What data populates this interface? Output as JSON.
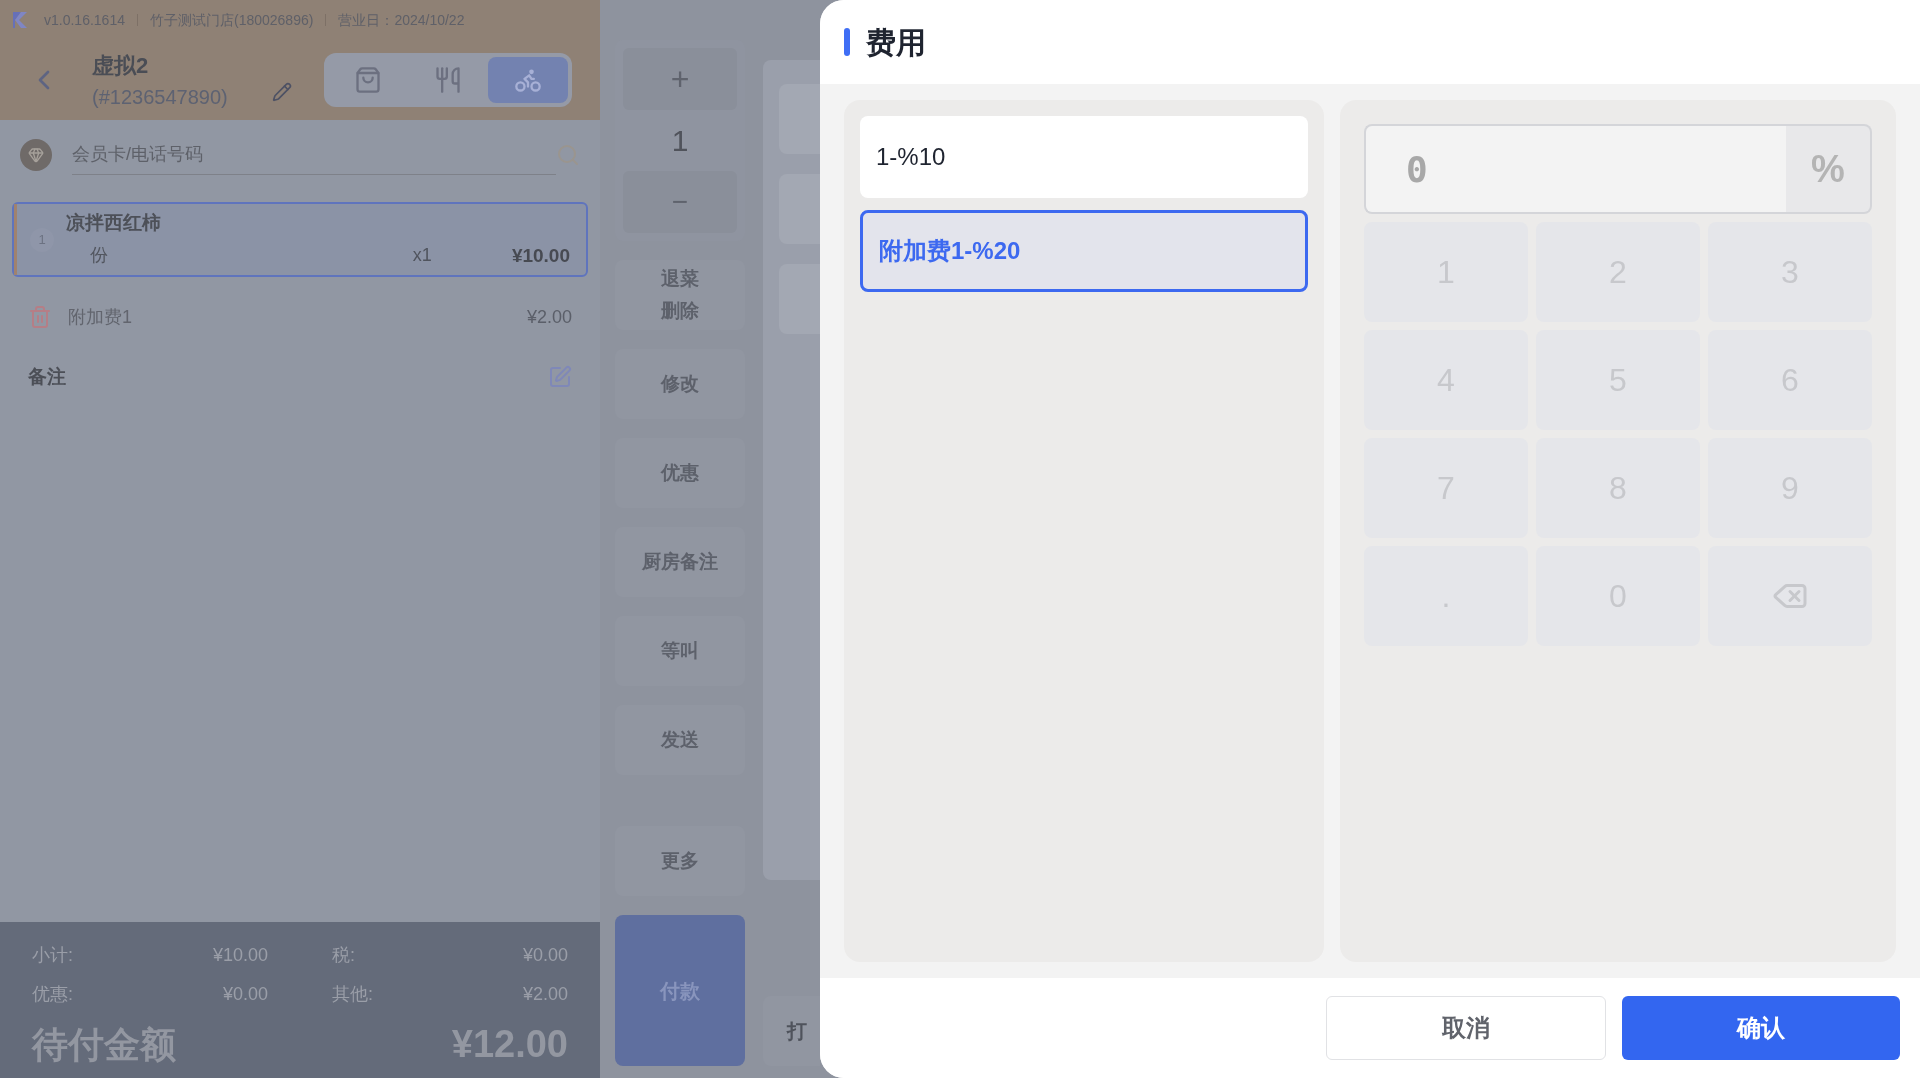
{
  "status_bar": {
    "version": "v1.0.16.1614",
    "store": "竹子测试门店(180026896)",
    "business_day": "营业日：2024/10/22"
  },
  "order": {
    "title": "虚拟2",
    "number": "(#1236547890)"
  },
  "mode_tabs": [
    {
      "kind": "bag",
      "selected": false
    },
    {
      "kind": "dine",
      "selected": false
    },
    {
      "kind": "delivery",
      "selected": true
    }
  ],
  "member_search": {
    "placeholder": "会员卡/电话号码"
  },
  "items": [
    {
      "index": "1",
      "name": "凉拌西红柿",
      "unit": "份",
      "qty": "x1",
      "price": "¥10.00",
      "selected": true
    }
  ],
  "surcharges": [
    {
      "name": "附加费1",
      "amount": "¥2.00"
    }
  ],
  "note_label": "备注",
  "summary": [
    {
      "label": "小计:",
      "value": "¥10.00"
    },
    {
      "label": "税:",
      "value": "¥0.00"
    },
    {
      "label": "优惠:",
      "value": "¥0.00"
    },
    {
      "label": "其他:",
      "value": "¥2.00"
    }
  ],
  "total": {
    "label": "待付金额",
    "value": "¥12.00"
  },
  "quantity": {
    "plus": "+",
    "value": "1",
    "minus": "−"
  },
  "actions": [
    {
      "lines": [
        "退菜",
        "删除"
      ]
    },
    {
      "lines": [
        "修改"
      ]
    },
    {
      "lines": [
        "优惠"
      ]
    },
    {
      "lines": [
        "厨房备注"
      ]
    },
    {
      "lines": [
        "等叫"
      ]
    },
    {
      "lines": [
        "发送"
      ]
    },
    {
      "lines": [
        "更多"
      ]
    }
  ],
  "pay_button": "付款",
  "partial_button": "打",
  "dialog": {
    "title": "费用",
    "options": [
      {
        "label": "1-%10",
        "selected": false
      },
      {
        "label": "附加费1-%20",
        "selected": true
      }
    ],
    "input": {
      "placeholder": "0",
      "unit": "%"
    },
    "keys": [
      {
        "kind": "digit",
        "label": "1"
      },
      {
        "kind": "digit",
        "label": "2"
      },
      {
        "kind": "digit",
        "label": "3"
      },
      {
        "kind": "digit",
        "label": "4"
      },
      {
        "kind": "digit",
        "label": "5"
      },
      {
        "kind": "digit",
        "label": "6"
      },
      {
        "kind": "digit",
        "label": "7"
      },
      {
        "kind": "digit",
        "label": "8"
      },
      {
        "kind": "digit",
        "label": "9"
      },
      {
        "kind": "digit",
        "label": "."
      },
      {
        "kind": "digit",
        "label": "0"
      },
      {
        "kind": "backspace"
      }
    ],
    "cancel": "取消",
    "confirm": "确认"
  }
}
